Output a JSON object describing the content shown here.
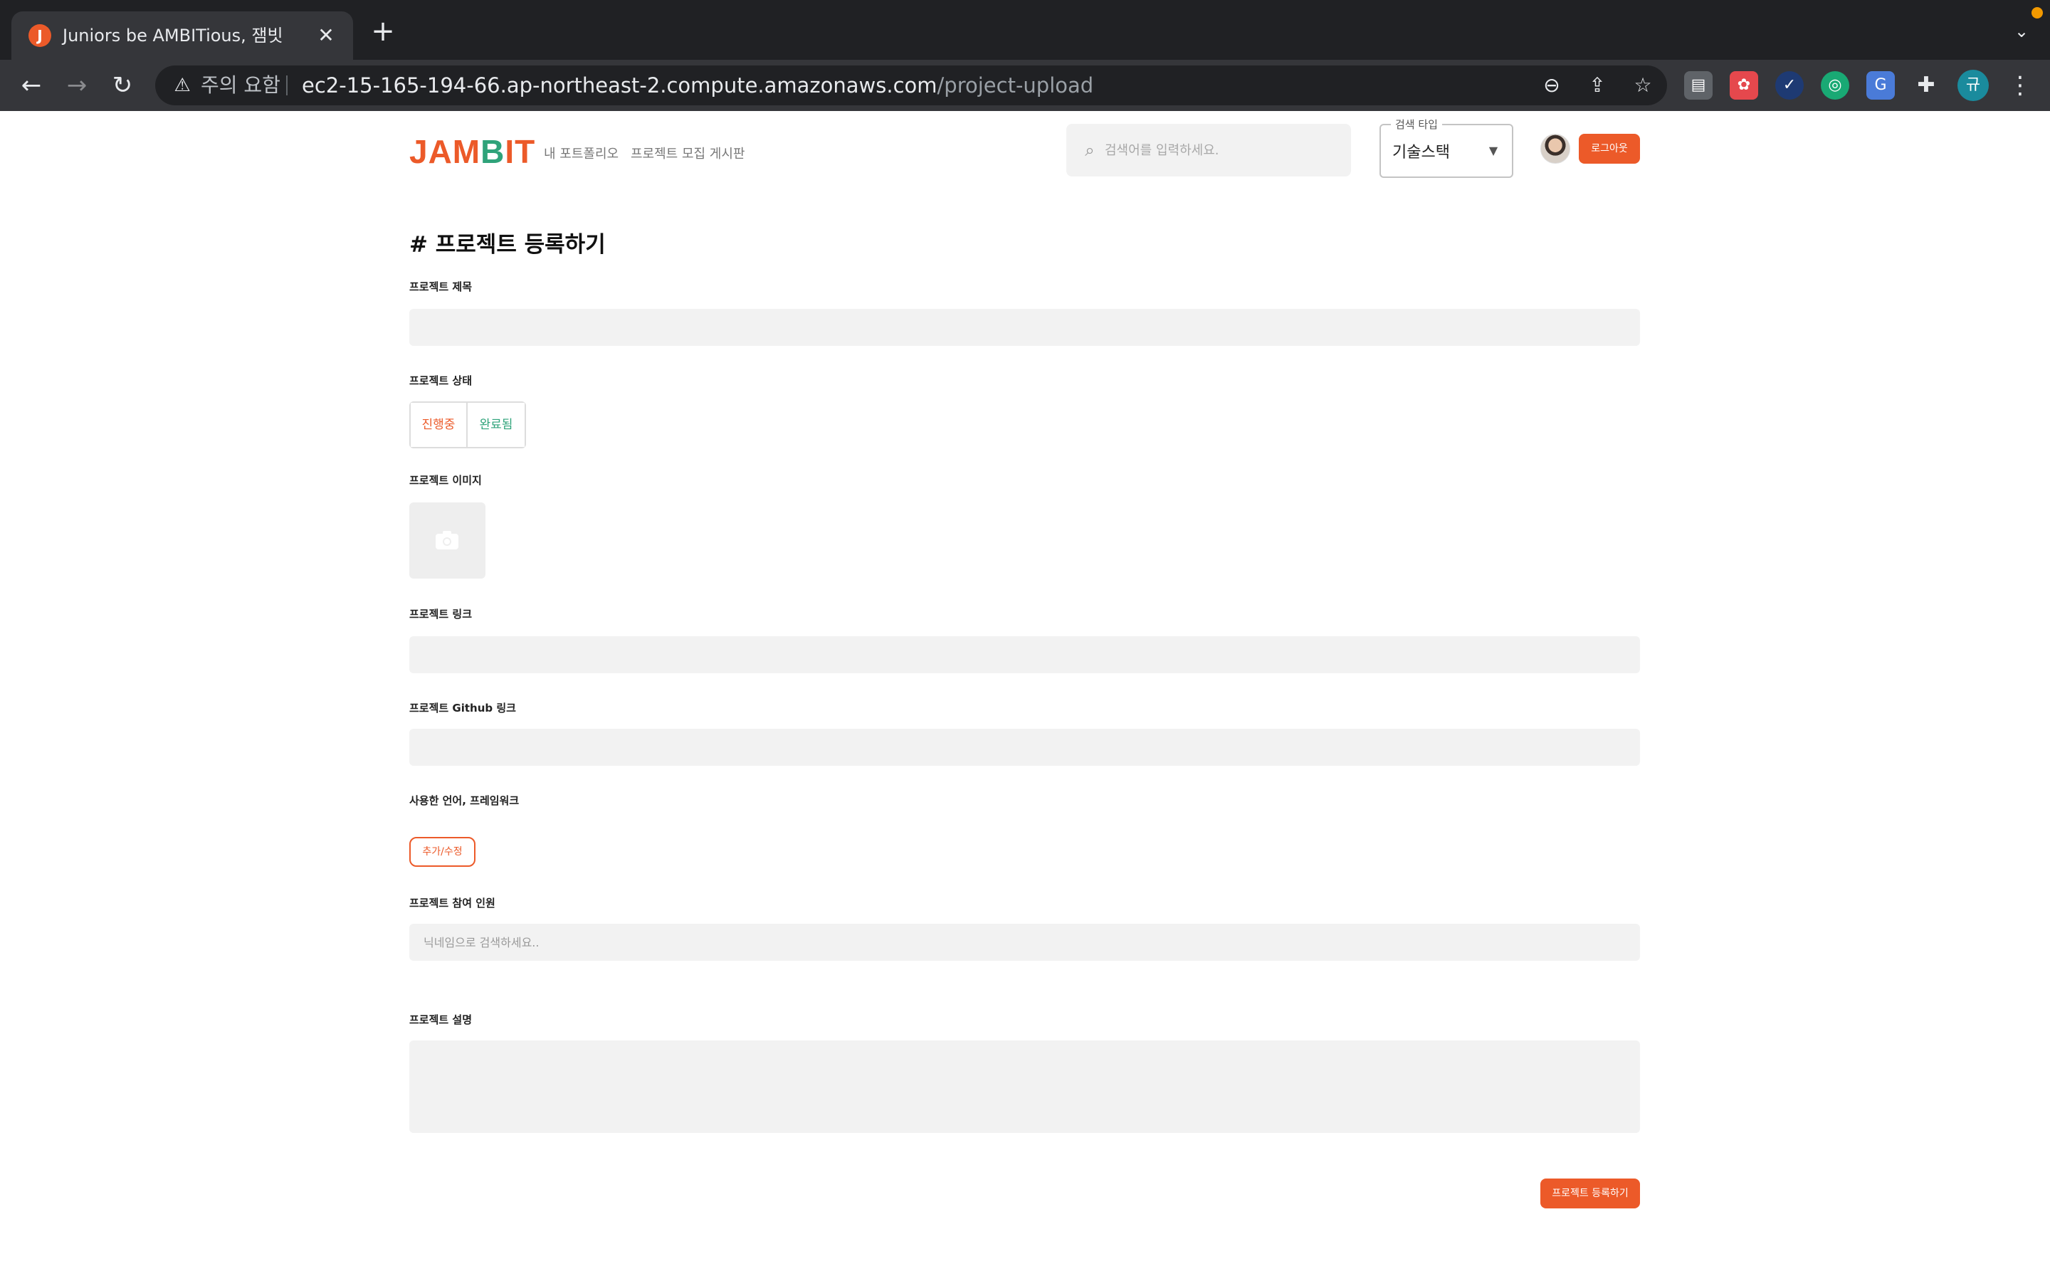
{
  "browser": {
    "tab_title": "Juniors be AMBITious, 잼빗",
    "tab_favicon_letter": "J",
    "security_warning": "주의 요함",
    "url_host": "ec2-15-165-194-66.ap-northeast-2.compute.amazonaws.com",
    "url_path": "/project-upload",
    "profile_initial": "규"
  },
  "header": {
    "logo_main": "JAM",
    "logo_accent": "B",
    "logo_tail": "IT",
    "nav": [
      "내 포트폴리오",
      "프로젝트 모집 게시판"
    ],
    "search_placeholder": "검색어를 입력하세요.",
    "search_type_label": "검색 타입",
    "search_type_value": "기술스택",
    "logout_label": "로그아웃"
  },
  "form": {
    "title": "# 프로젝트 등록하기",
    "project_title_label": "프로젝트 제목",
    "status_label": "프로젝트 상태",
    "status_options": [
      "진행중",
      "완료됨"
    ],
    "image_label": "프로젝트 이미지",
    "link_label": "프로젝트 링크",
    "github_label": "프로젝트 Github 링크",
    "stack_label": "사용한 언어, 프레임워크",
    "stack_button": "추가/수정",
    "members_label": "프로젝트 참여 인원",
    "members_placeholder": "닉네임으로 검색하세요..",
    "description_label": "프로젝트 설명",
    "submit_label": "프로젝트 등록하기"
  },
  "colors": {
    "brand_orange": "#ec5a29",
    "brand_green": "#2fa37a"
  }
}
